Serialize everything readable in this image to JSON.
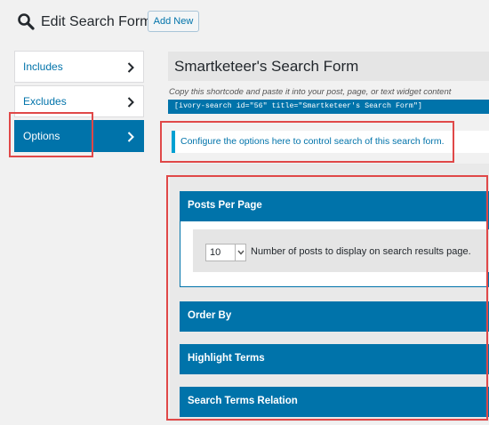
{
  "header": {
    "search_icon": "search-icon",
    "title": "Edit Search Form",
    "add_new_label": "Add New"
  },
  "sidebar": {
    "items": [
      {
        "label": "Includes",
        "icon": "chevron-right-icon",
        "active": false
      },
      {
        "label": "Excludes",
        "icon": "chevron-right-icon",
        "active": false
      },
      {
        "label": "Options",
        "icon": "chevron-right-icon",
        "active": true
      }
    ]
  },
  "form": {
    "title": "Smartketeer's Search Form",
    "shortcode_hint": "Copy this shortcode and paste it into your post, page, or text widget content",
    "shortcode": "[ivory-search id=\"56\" title=\"Smartketeer's Search Form\"]"
  },
  "notice": {
    "text": "Configure the options here to control search of this search form."
  },
  "options": {
    "sections": [
      {
        "label": "Posts Per Page",
        "expanded": true
      },
      {
        "label": "Order By",
        "expanded": false
      },
      {
        "label": "Highlight Terms",
        "expanded": false
      },
      {
        "label": "Search Terms Relation",
        "expanded": false
      }
    ],
    "posts_per_page": {
      "value": "10",
      "description": "Number of posts to display on search results page."
    }
  },
  "colors": {
    "accent": "#0073aa",
    "highlight_outline": "#e04848",
    "notice_border": "#00a0d2"
  }
}
